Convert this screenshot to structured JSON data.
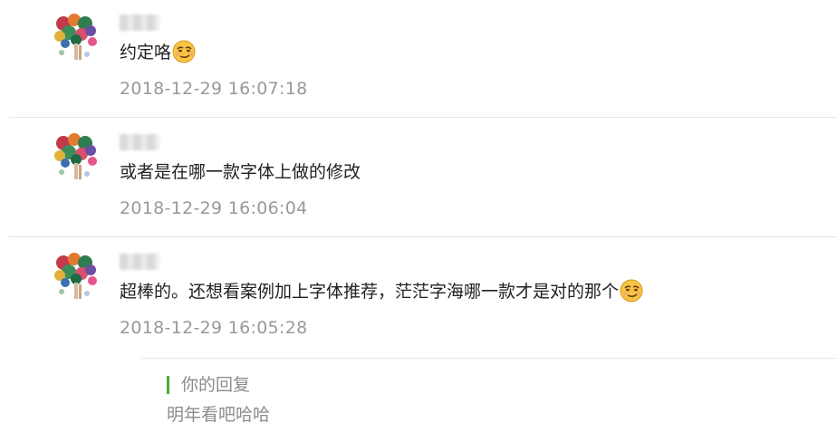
{
  "comments": [
    {
      "text": "约定咯",
      "emoji": "smirk-emoji",
      "time": "2018-12-29 16:07:18"
    },
    {
      "text": "或者是在哪一款字体上做的修改",
      "emoji": "",
      "time": "2018-12-29 16:06:04"
    },
    {
      "text": "超棒的。还想看案例加上字体推荐，茫茫字海哪一款才是对的那个",
      "emoji": "smirk-emoji",
      "time": "2018-12-29 16:05:28"
    }
  ],
  "reply": {
    "label": "你的回复",
    "text": "明年看吧哈哈"
  },
  "colors": {
    "reply_accent": "#4cab3a",
    "timestamp": "#999999",
    "divider": "#e6e6e6"
  }
}
